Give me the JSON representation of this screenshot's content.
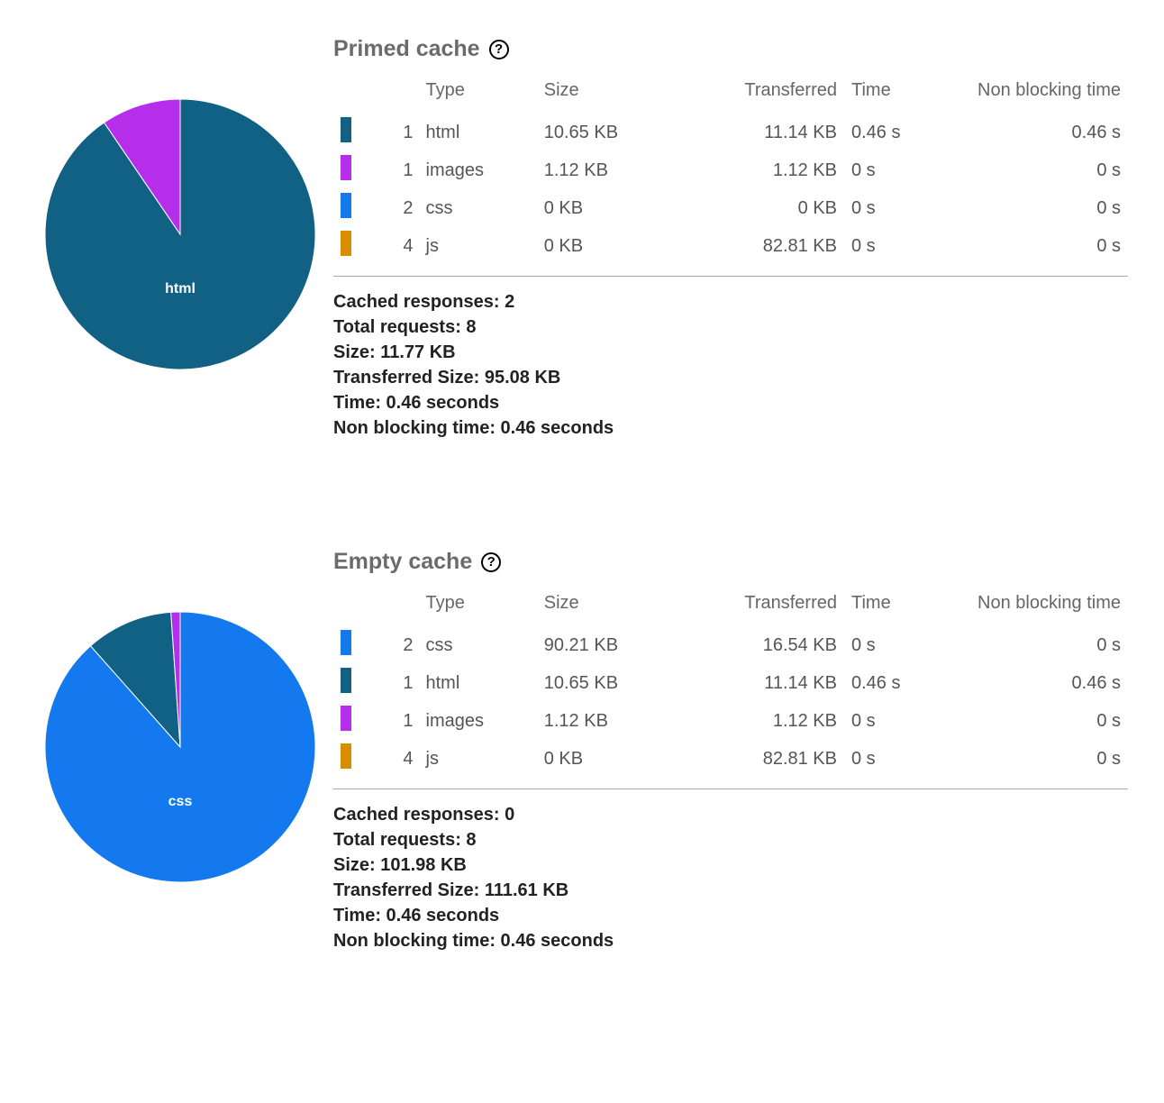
{
  "columns": {
    "type": "Type",
    "size": "Size",
    "transferred": "Transferred",
    "time": "Time",
    "non_blocking": "Non blocking time"
  },
  "colors": {
    "html": "#116184",
    "images": "#b52eea",
    "css": "#1479ee",
    "js": "#d88c00"
  },
  "sections": [
    {
      "title": "Primed cache",
      "rows": [
        {
          "color_key": "html",
          "count": 1,
          "type": "html",
          "size": "10.65 KB",
          "transferred": "11.14 KB",
          "time": "0.46 s",
          "non_blocking": "0.46 s"
        },
        {
          "color_key": "images",
          "count": 1,
          "type": "images",
          "size": "1.12 KB",
          "transferred": "1.12 KB",
          "time": "0 s",
          "non_blocking": "0 s"
        },
        {
          "color_key": "css",
          "count": 2,
          "type": "css",
          "size": "0 KB",
          "transferred": "0 KB",
          "time": "0 s",
          "non_blocking": "0 s"
        },
        {
          "color_key": "js",
          "count": 4,
          "type": "js",
          "size": "0 KB",
          "transferred": "82.81 KB",
          "time": "0 s",
          "non_blocking": "0 s"
        }
      ],
      "summary": [
        "Cached responses: 2",
        "Total requests: 8",
        "Size: 11.77 KB",
        "Transferred Size: 95.08 KB",
        "Time: 0.46 seconds",
        "Non blocking time: 0.46 seconds"
      ],
      "pie_dominant_label": "html"
    },
    {
      "title": "Empty cache",
      "rows": [
        {
          "color_key": "css",
          "count": 2,
          "type": "css",
          "size": "90.21 KB",
          "transferred": "16.54 KB",
          "time": "0 s",
          "non_blocking": "0 s"
        },
        {
          "color_key": "html",
          "count": 1,
          "type": "html",
          "size": "10.65 KB",
          "transferred": "11.14 KB",
          "time": "0.46 s",
          "non_blocking": "0.46 s"
        },
        {
          "color_key": "images",
          "count": 1,
          "type": "images",
          "size": "1.12 KB",
          "transferred": "1.12 KB",
          "time": "0 s",
          "non_blocking": "0 s"
        },
        {
          "color_key": "js",
          "count": 4,
          "type": "js",
          "size": "0 KB",
          "transferred": "82.81 KB",
          "time": "0 s",
          "non_blocking": "0 s"
        }
      ],
      "summary": [
        "Cached responses: 0",
        "Total requests: 8",
        "Size: 101.98 KB",
        "Transferred Size: 111.61 KB",
        "Time: 0.46 seconds",
        "Non blocking time: 0.46 seconds"
      ],
      "pie_dominant_label": "css"
    }
  ],
  "chart_data": [
    {
      "type": "pie",
      "title": "Primed cache",
      "unit": "KB (Size)",
      "slices": [
        {
          "name": "html",
          "value": 10.65,
          "color": "#116184"
        },
        {
          "name": "images",
          "value": 1.12,
          "color": "#b52eea"
        },
        {
          "name": "css",
          "value": 0,
          "color": "#1479ee"
        },
        {
          "name": "js",
          "value": 0,
          "color": "#d88c00"
        }
      ],
      "dominant_label": "html"
    },
    {
      "type": "pie",
      "title": "Empty cache",
      "unit": "KB (Size)",
      "slices": [
        {
          "name": "css",
          "value": 90.21,
          "color": "#1479ee"
        },
        {
          "name": "html",
          "value": 10.65,
          "color": "#116184"
        },
        {
          "name": "images",
          "value": 1.12,
          "color": "#b52eea"
        },
        {
          "name": "js",
          "value": 0,
          "color": "#d88c00"
        }
      ],
      "dominant_label": "css"
    }
  ]
}
